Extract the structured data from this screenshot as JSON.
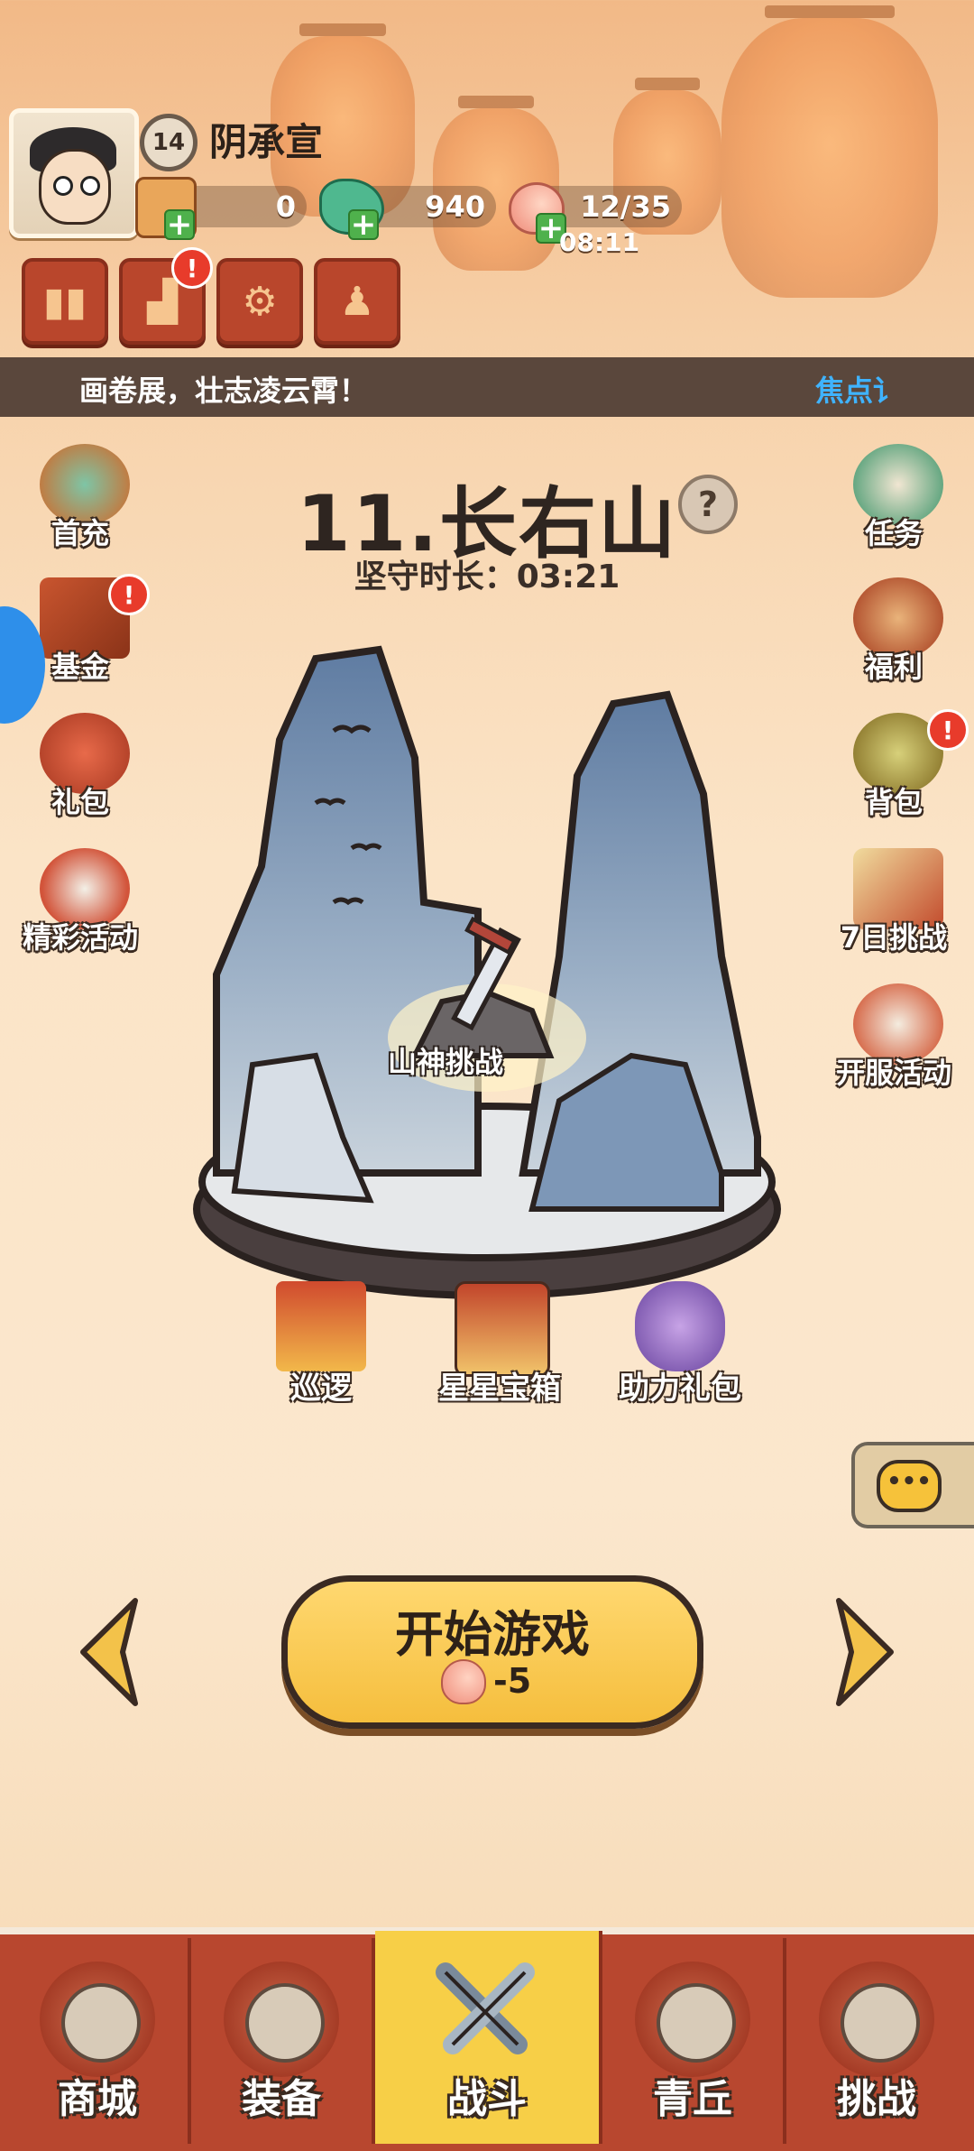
{
  "player": {
    "level": "14",
    "name": "阴承宣"
  },
  "resources": {
    "scrolls": "0",
    "jade": "940",
    "stamina": "12/35",
    "stamina_timer": "08:11"
  },
  "marquee": {
    "text": "画卷展，壮志凌云霄！",
    "link": "焦点讠"
  },
  "left_menu": [
    {
      "label": "首充",
      "icon": "first-recharge-icon"
    },
    {
      "label": "基金",
      "icon": "fund-icon"
    },
    {
      "label": "礼包",
      "icon": "gift-pack-icon"
    },
    {
      "label": "精彩活动",
      "icon": "events-icon"
    }
  ],
  "right_menu": [
    {
      "label": "任务",
      "icon": "quest-scroll-icon"
    },
    {
      "label": "福利",
      "icon": "welfare-bag-icon"
    },
    {
      "label": "背包",
      "icon": "backpack-icon"
    },
    {
      "label": "7日挑战",
      "icon": "seven-day-icon"
    },
    {
      "label": "开服活动",
      "icon": "server-launch-icon"
    }
  ],
  "stage": {
    "title": "11.长右山",
    "help": "?",
    "guard_time": "坚守时长：03:21",
    "boss_label": "山神挑战"
  },
  "stage_chests": [
    {
      "label": "巡逻",
      "icon": "patrol-flag-icon"
    },
    {
      "label": "星星宝箱",
      "icon": "star-chest-icon"
    },
    {
      "label": "助力礼包",
      "icon": "support-bag-icon"
    }
  ],
  "start": {
    "label": "开始游戏",
    "cost": "-5"
  },
  "bottom_nav": [
    {
      "label": "商城",
      "icon": "shop-icon",
      "active": false
    },
    {
      "label": "装备",
      "icon": "equipment-icon",
      "active": false
    },
    {
      "label": "战斗",
      "icon": "battle-swords-icon",
      "active": true
    },
    {
      "label": "青丘",
      "icon": "qingqiu-icon",
      "active": false
    },
    {
      "label": "挑战",
      "icon": "challenge-icon",
      "active": false
    }
  ],
  "colors": {
    "accent_yellow": "#f5be3d",
    "nav_red": "#b8472f",
    "link_blue": "#3fb3ff"
  }
}
